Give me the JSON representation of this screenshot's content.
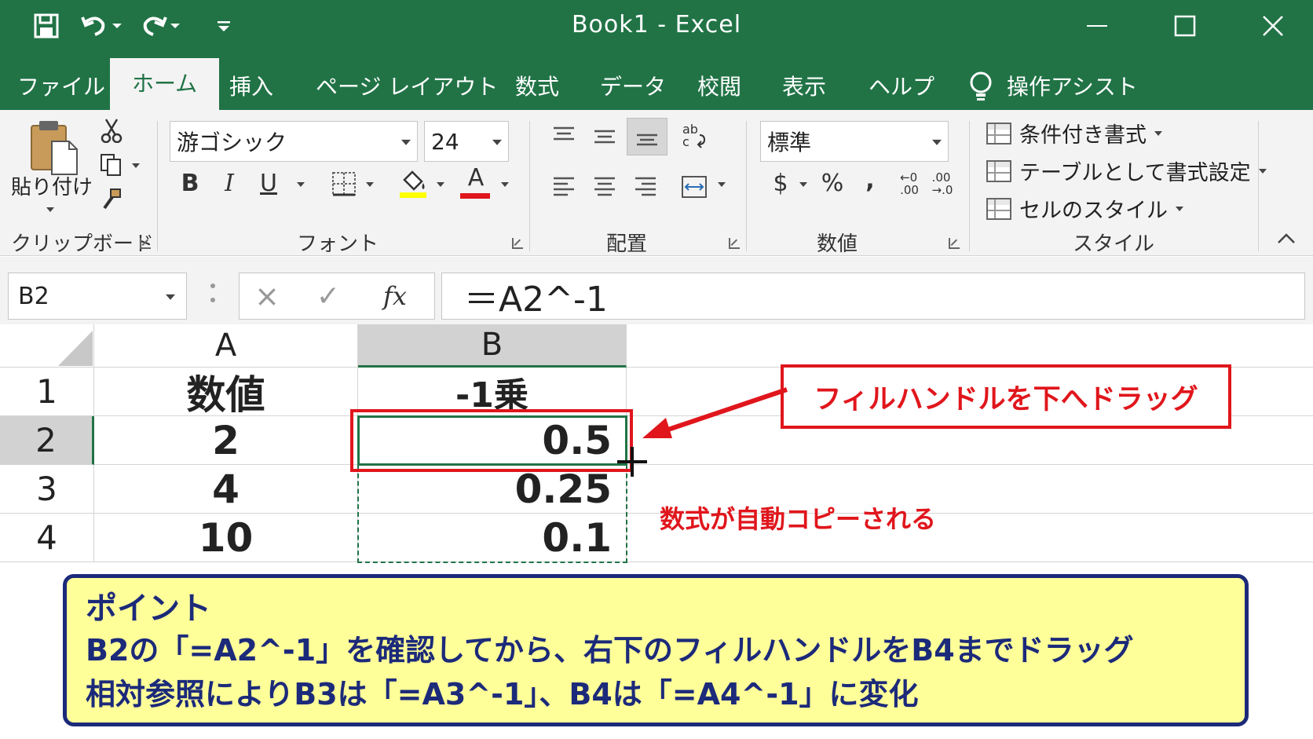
{
  "window": {
    "title": "Book1  -  Excel"
  },
  "quick_access": {
    "save": "save-icon",
    "undo": "undo-icon",
    "redo": "redo-icon",
    "customize": "customize-icon"
  },
  "window_controls": {
    "minimize": "minimize-icon",
    "maximize": "maximize-icon",
    "close": "close-icon"
  },
  "tabs": [
    "ファイル",
    "ホーム",
    "挿入",
    "ページ レイアウト",
    "数式",
    "データ",
    "校閲",
    "表示",
    "ヘルプ",
    "操作アシスト"
  ],
  "active_tab": "ホーム",
  "ribbon": {
    "clipboard": {
      "paste_label": "貼り付け",
      "group_label": "クリップボード"
    },
    "font": {
      "name": "游ゴシック",
      "size": "24",
      "bold": "B",
      "italic": "I",
      "underline": "U",
      "font_color": "A",
      "group_label": "フォント"
    },
    "alignment": {
      "group_label": "配置"
    },
    "number": {
      "format": "標準",
      "currency": "$",
      "percent": "%",
      "comma": ",",
      "inc_decimal": "←0\n.00",
      "dec_decimal": ".00\n→.0",
      "group_label": "数値"
    },
    "styles": {
      "conditional": "条件付き書式",
      "table": "テーブルとして書式設定",
      "cell_styles": "セルのスタイル",
      "group_label": "スタイル"
    }
  },
  "formula_bar": {
    "name_box": "B2",
    "cancel": "×",
    "enter": "✓",
    "fx": "fx",
    "formula": "＝A2^-1"
  },
  "sheet": {
    "columns": [
      "A",
      "B"
    ],
    "rows": [
      {
        "num": "1",
        "A": "数値",
        "B": "-1乗"
      },
      {
        "num": "2",
        "A": "2",
        "B": "0.5"
      },
      {
        "num": "3",
        "A": "4",
        "B": "0.25"
      },
      {
        "num": "4",
        "A": "10",
        "B": "0.1"
      }
    ],
    "selected_cell": "B2"
  },
  "annotations": {
    "callout": "フィルハンドルを下へドラッグ",
    "copy_note": "数式が自動コピーされる",
    "point_title": "ポイント",
    "point_line1": "B2の「=A2^-1」を確認してから、右下のフィルハンドルをB4までドラッグ",
    "point_line2": "相対参照によりB3は「=A3^-1」、B4は「=A4^-1」に変化"
  },
  "colors": {
    "excel_green": "#217346",
    "callout_red": "#e0161c",
    "point_bg": "#ffff99",
    "point_border": "#1c2a7a"
  }
}
